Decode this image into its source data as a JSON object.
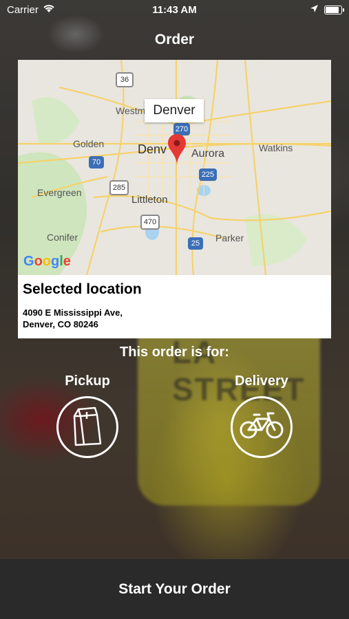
{
  "status_bar": {
    "carrier": "Carrier",
    "time": "11:43 AM",
    "battery_level": 0.95
  },
  "header": {
    "title": "Order"
  },
  "map": {
    "tooltip": "Denver",
    "attribution": "Google",
    "place_labels": [
      "Westm",
      "Golden",
      "Denv",
      "Aurora",
      "Watkins",
      "Evergreen",
      "Littleton",
      "Conifer",
      "Parker"
    ],
    "highway_shields": [
      "36",
      "270",
      "70",
      "285",
      "225",
      "470",
      "25"
    ]
  },
  "location": {
    "title": "Selected location",
    "address_line1": "4090 E Mississippi Ave,",
    "address_line2": "Denver, CO 80246"
  },
  "order_type": {
    "prompt": "This order is for:",
    "pickup_label": "Pickup",
    "delivery_label": "Delivery"
  },
  "footer": {
    "cta_label": "Start Your Order"
  },
  "colors": {
    "map_road": "#f5d26b",
    "map_park": "#c9e3b4",
    "pin": "#e53935",
    "footer": "#2a2a2a"
  }
}
